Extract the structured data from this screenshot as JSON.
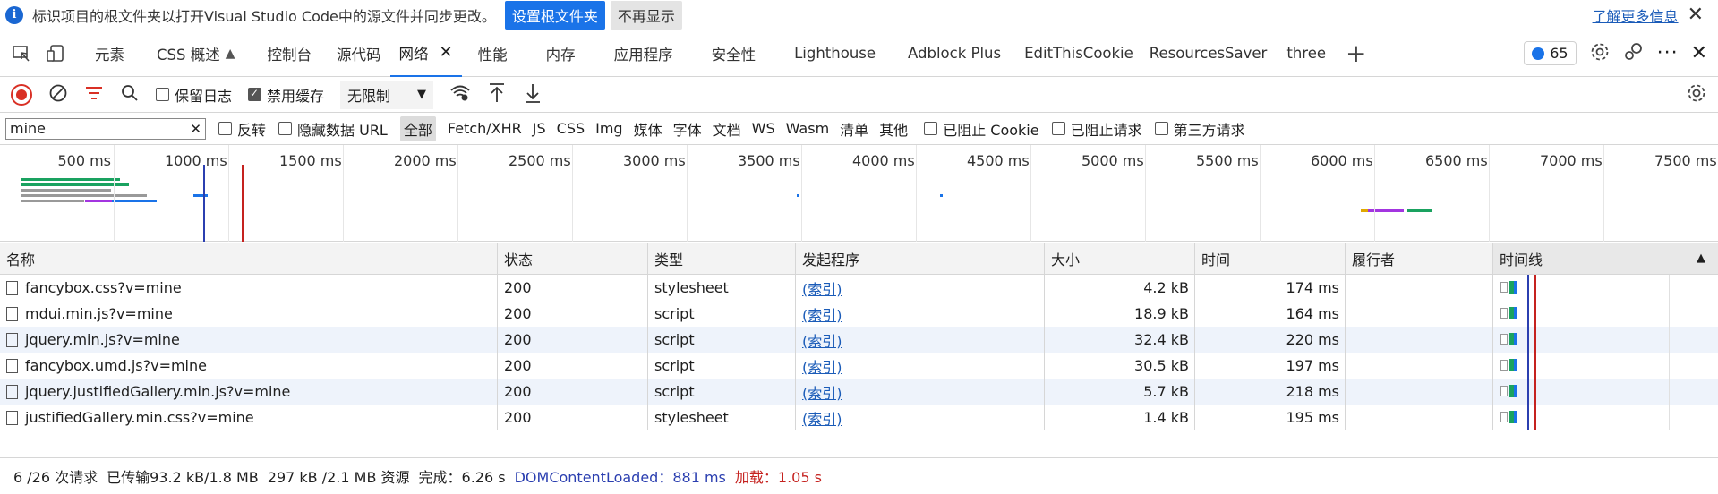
{
  "infobar": {
    "text": "标识项目的根文件夹以打开Visual Studio Code中的源文件并同步更改。",
    "primary_button": "设置根文件夹",
    "secondary_button": "不再显示",
    "link": "了解更多信息",
    "close": "✕"
  },
  "tabs": [
    {
      "label": "元素"
    },
    {
      "label": "CSS 概述"
    },
    {
      "label": "控制台"
    },
    {
      "label": "源代码"
    },
    {
      "label": "网络",
      "active": true
    },
    {
      "label": "性能"
    },
    {
      "label": "内存"
    },
    {
      "label": "应用程序"
    },
    {
      "label": "安全性"
    },
    {
      "label": "Lighthouse"
    },
    {
      "label": "Adblock Plus"
    },
    {
      "label": "EditThisCookie"
    },
    {
      "label": "ResourcesSaver"
    },
    {
      "label": "three"
    }
  ],
  "tab_close": "✕",
  "issues_count": "65",
  "toolbar": {
    "preserve_log": "保留日志",
    "disable_cache": "禁用缓存",
    "throttle": "无限制"
  },
  "filter": {
    "value": "mine",
    "invert": "反转",
    "hide_data_urls": "隐藏数据 URL",
    "types": [
      "全部",
      "Fetch/XHR",
      "JS",
      "CSS",
      "Img",
      "媒体",
      "字体",
      "文档",
      "WS",
      "Wasm",
      "清单",
      "其他"
    ],
    "blocked_cookies": "已阻止 Cookie",
    "blocked_requests": "已阻止请求",
    "third_party": "第三方请求"
  },
  "overview_ticks": [
    "500 ms",
    "1000 ms",
    "1500 ms",
    "2000 ms",
    "2500 ms",
    "3000 ms",
    "3500 ms",
    "4000 ms",
    "4500 ms",
    "5000 ms",
    "5500 ms",
    "6000 ms",
    "6500 ms",
    "7000 ms",
    "7500 ms"
  ],
  "columns": {
    "name": "名称",
    "status": "状态",
    "type": "类型",
    "initiator": "发起程序",
    "size": "大小",
    "time": "时间",
    "fulfilled_by": "履行者",
    "waterfall": "时间线",
    "sort_icon": "▲"
  },
  "rows": [
    {
      "name": "fancybox.css?v=mine",
      "status": "200",
      "type": "stylesheet",
      "initiator": "(索引)",
      "size": "4.2 kB",
      "time": "174 ms"
    },
    {
      "name": "mdui.min.js?v=mine",
      "status": "200",
      "type": "script",
      "initiator": "(索引)",
      "size": "18.9 kB",
      "time": "164 ms"
    },
    {
      "name": "jquery.min.js?v=mine",
      "status": "200",
      "type": "script",
      "initiator": "(索引)",
      "size": "32.4 kB",
      "time": "220 ms"
    },
    {
      "name": "fancybox.umd.js?v=mine",
      "status": "200",
      "type": "script",
      "initiator": "(索引)",
      "size": "30.5 kB",
      "time": "197 ms"
    },
    {
      "name": "jquery.justifiedGallery.min.js?v=mine",
      "status": "200",
      "type": "script",
      "initiator": "(索引)",
      "size": "5.7 kB",
      "time": "218 ms"
    },
    {
      "name": "justifiedGallery.min.css?v=mine",
      "status": "200",
      "type": "stylesheet",
      "initiator": "(索引)",
      "size": "1.4 kB",
      "time": "195 ms"
    }
  ],
  "status": {
    "requests": "6 /26 次请求",
    "transferred": "已传输93.2 kB/1.8 MB",
    "resources": "297 kB /2.1 MB 资源",
    "finish": "完成：6.26 s",
    "dcl": "DOMContentLoaded：881 ms",
    "load": "加载：1.05 s"
  },
  "colors": {
    "accent": "#1a73e8",
    "record": "#d93025",
    "dcl": "#2b3fb0",
    "load": "#c5221f"
  }
}
